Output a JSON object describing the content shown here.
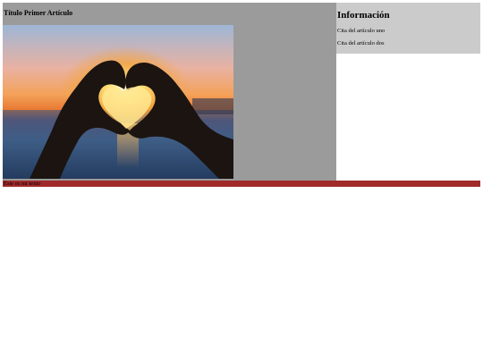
{
  "main": {
    "article_title": "Título Primer Artículo",
    "image": {
      "subject": "hands-heart-sunset"
    }
  },
  "aside": {
    "heading": "Información",
    "items": [
      {
        "label": "Cita del artículo uno"
      },
      {
        "label": "Cita del artículo dos"
      }
    ]
  },
  "footer": {
    "text": "Este es mi texto"
  },
  "colors": {
    "main_bg": "#9b9b9b",
    "aside_bg": "#cbcbcb",
    "footer_bg": "#a02a2a"
  }
}
